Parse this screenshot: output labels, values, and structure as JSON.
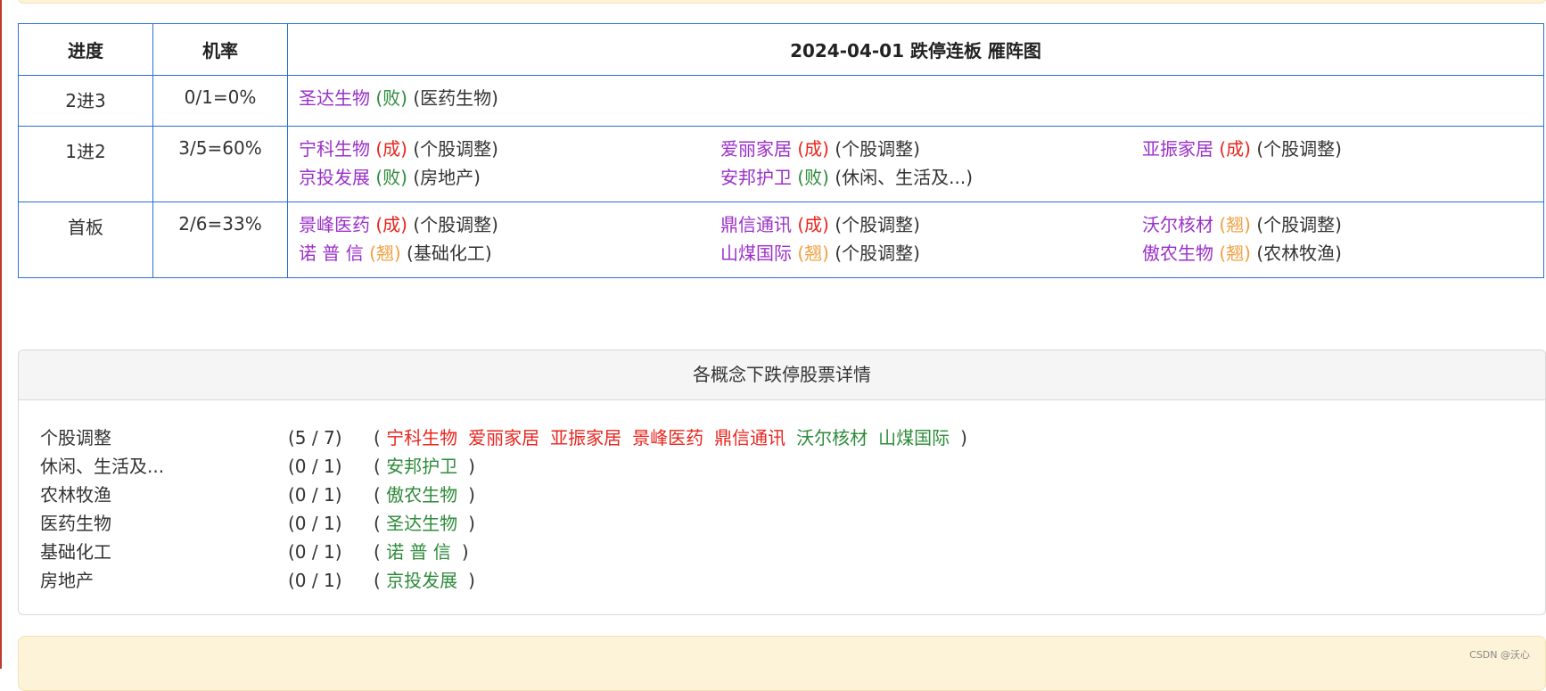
{
  "ladder": {
    "headers": {
      "progress": "进度",
      "rate": "机率",
      "title": "2024-04-01 跌停连板 雁阵图"
    },
    "rows": [
      {
        "progress": "2进3",
        "rate": "0/1=0%",
        "stocks": [
          {
            "name": "圣达生物",
            "result": "(败)",
            "kind": "lose",
            "sector": "(医药生物)"
          }
        ]
      },
      {
        "progress": "1进2",
        "rate": "3/5=60%",
        "stocks": [
          {
            "name": "宁科生物",
            "result": "(成)",
            "kind": "win",
            "sector": "(个股调整)"
          },
          {
            "name": "爱丽家居",
            "result": "(成)",
            "kind": "win",
            "sector": "(个股调整)"
          },
          {
            "name": "亚振家居",
            "result": "(成)",
            "kind": "win",
            "sector": "(个股调整)"
          },
          {
            "name": "京投发展",
            "result": "(败)",
            "kind": "lose",
            "sector": "(房地产)"
          },
          {
            "name": "安邦护卫",
            "result": "(败)",
            "kind": "lose",
            "sector": "(休闲、生活及...)"
          }
        ]
      },
      {
        "progress": "首板",
        "rate": "2/6=33%",
        "stocks": [
          {
            "name": "景峰医药",
            "result": "(成)",
            "kind": "win",
            "sector": "(个股调整)"
          },
          {
            "name": "鼎信通讯",
            "result": "(成)",
            "kind": "win",
            "sector": "(个股调整)"
          },
          {
            "name": "沃尔核材",
            "result": "(翘)",
            "kind": "wing",
            "sector": "(个股调整)"
          },
          {
            "name": "诺 普 信",
            "result": "(翘)",
            "kind": "wing",
            "sector": "(基础化工)"
          },
          {
            "name": "山煤国际",
            "result": "(翘)",
            "kind": "wing",
            "sector": "(个股调整)"
          },
          {
            "name": "傲农生物",
            "result": "(翘)",
            "kind": "wing",
            "sector": "(农林牧渔)"
          }
        ]
      }
    ]
  },
  "concepts": {
    "title": "各概念下跌停股票详情",
    "items": [
      {
        "name": "个股调整",
        "count": "(5 / 7)",
        "stocks": [
          {
            "name": "宁科生物",
            "kind": "win"
          },
          {
            "name": "爱丽家居",
            "kind": "win"
          },
          {
            "name": "亚振家居",
            "kind": "win"
          },
          {
            "name": "景峰医药",
            "kind": "win"
          },
          {
            "name": "鼎信通讯",
            "kind": "win"
          },
          {
            "name": "沃尔核材",
            "kind": "lose"
          },
          {
            "name": "山煤国际",
            "kind": "lose"
          }
        ]
      },
      {
        "name": "休闲、生活及...",
        "count": "(0 / 1)",
        "stocks": [
          {
            "name": "安邦护卫",
            "kind": "lose"
          }
        ]
      },
      {
        "name": "农林牧渔",
        "count": "(0 / 1)",
        "stocks": [
          {
            "name": "傲农生物",
            "kind": "lose"
          }
        ]
      },
      {
        "name": "医药生物",
        "count": "(0 / 1)",
        "stocks": [
          {
            "name": "圣达生物",
            "kind": "lose"
          }
        ]
      },
      {
        "name": "基础化工",
        "count": "(0 / 1)",
        "stocks": [
          {
            "name": "诺 普 信",
            "kind": "lose"
          }
        ]
      },
      {
        "name": "房地产",
        "count": "(0 / 1)",
        "stocks": [
          {
            "name": "京投发展",
            "kind": "lose"
          }
        ]
      }
    ]
  },
  "colors": {
    "border": "#2a6fd6",
    "stock_name": "#9b30c8",
    "win": "#e8261f",
    "lose": "#2e8b3a",
    "wing": "#f0a040"
  },
  "watermark": "CSDN @沃心"
}
